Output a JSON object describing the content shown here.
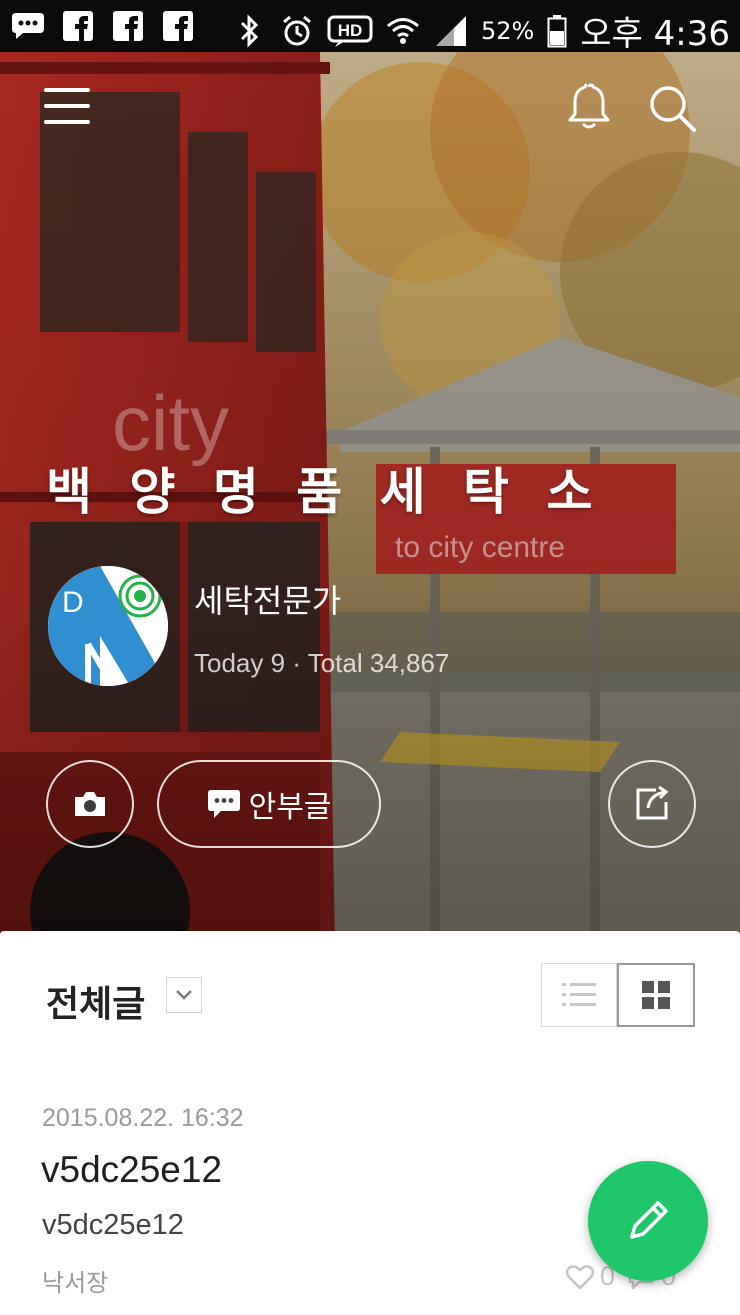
{
  "status_bar": {
    "notification_icons": [
      "talk-icon",
      "facebook-icon",
      "facebook-icon",
      "facebook-icon"
    ],
    "system_icons": [
      "bluetooth-icon",
      "alarm-icon",
      "hd-voice-icon",
      "wifi-icon",
      "signal-icon"
    ],
    "hd_label": "HD",
    "battery_percent": "52%",
    "battery_level": 0.52,
    "time": "오후 4:36"
  },
  "topnav": {
    "icons": [
      "menu-icon",
      "bell-icon",
      "search-icon"
    ]
  },
  "hero": {
    "background_colors": [
      "#b72c24",
      "#d7a24a",
      "#8a7a5a"
    ]
  },
  "blog": {
    "title": "백 양 명 품 세 탁 소",
    "avatar_letter": "D",
    "nickname": "세탁전문가",
    "visits": "Today 9 · Total 34,867"
  },
  "actions": {
    "anbu_label": "안부글"
  },
  "content": {
    "category_title": "전체글",
    "view_mode": "grid"
  },
  "post": {
    "date": "2015.08.22. 16:32",
    "title": "v5dc25e12",
    "body": "v5dc25e12",
    "category": "낙서장",
    "likes": "0",
    "comments": "0"
  },
  "colors": {
    "accent": "#1ec86a",
    "statusbar": "#0b0b0b"
  }
}
